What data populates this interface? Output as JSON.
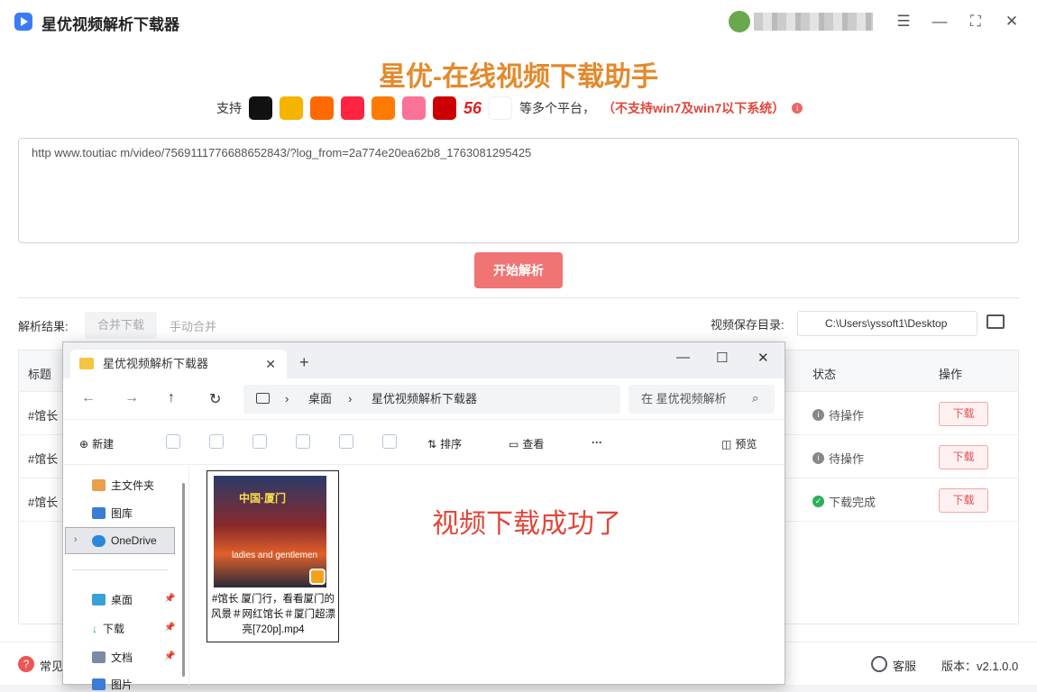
{
  "app": {
    "title": "星优视频解析下载器"
  },
  "window": {
    "settings_icon": "sliders-icon",
    "min": "—",
    "max": "⛶",
    "close": "✕"
  },
  "hero": {
    "title": "星优-在线视频下载助手",
    "support_prefix": "支持",
    "support_suffix": "等多个平台，",
    "warning": "（不支持win7及win7以下系统）",
    "platform_56": "56"
  },
  "platforms": [
    {
      "name": "douyin",
      "color": "#111"
    },
    {
      "name": "weibo",
      "color": "#f5b400"
    },
    {
      "name": "kuaishou",
      "color": "#ff6a00"
    },
    {
      "name": "xiaohongshu",
      "color": "#ff2442"
    },
    {
      "name": "tencent",
      "color": "#ff7a00"
    },
    {
      "name": "bilibili",
      "color": "#fb7299"
    },
    {
      "name": "cctv",
      "color": "#c00"
    }
  ],
  "url_input": {
    "value": "http   www.toutiac   m/video/7569111776688652843/?log_from=2a774e20ea62b8_1763081295425"
  },
  "start_btn": "开始解析",
  "results": {
    "label": "解析结果:",
    "merge": "合并下载",
    "manual": "手动合并",
    "save_label": "视频保存目录:",
    "save_path": "C:\\Users\\yssoft1\\Desktop"
  },
  "table": {
    "headers": {
      "title": "标题",
      "status": "状态",
      "action": "操作"
    },
    "rows": [
      {
        "title": "#馆长",
        "status": "待操作",
        "action": "下载"
      },
      {
        "title": "#馆长",
        "status": "待操作",
        "action": "下载"
      },
      {
        "title": "#馆长",
        "status": "下载完成",
        "action": "下载"
      }
    ]
  },
  "footer": {
    "help": "常见",
    "service": "客服",
    "version": "版本：v2.1.0.0"
  },
  "explorer": {
    "tab": "星优视频解析下载器",
    "crumb1": "桌面",
    "crumb2": "星优视频解析下载器",
    "search": "在 星优视频解析",
    "toolbar": {
      "new": "新建",
      "sort": "排序",
      "view": "查看",
      "more": "···",
      "preview": "预览"
    },
    "nav": {
      "home": "主文件夹",
      "gallery": "图库",
      "onedrive": "OneDrive",
      "desktop": "桌面",
      "downloads": "下载",
      "docs": "文档",
      "pics": "图片"
    },
    "file": {
      "name": "#馆长 厦门行，看看厦门的风景＃网红馆长＃厦门超漂亮[720p].mp4",
      "thumb_top": "中国·厦门",
      "thumb_sub": "ladies and gentlemen"
    },
    "success": "视频下载成功了"
  }
}
